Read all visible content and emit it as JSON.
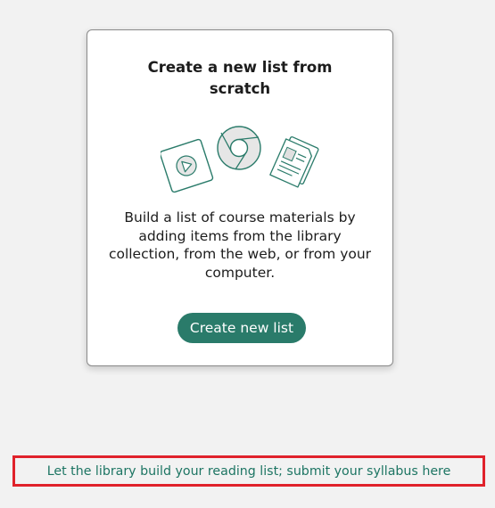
{
  "card": {
    "title": "Create a new list from scratch",
    "description": "Build a list of course materials by adding items from the library collection, from the web, or from your computer.",
    "button_label": "Create new list"
  },
  "illustration_icons": [
    "video-play-icon",
    "web-browser-icon",
    "document-icon"
  ],
  "footer": {
    "syllabus_link": "Let the library build your reading list; submit your syllabus here"
  },
  "colors": {
    "accent": "#2a7b6a",
    "link": "#1d7563",
    "highlight_border": "#e0222b",
    "background": "#f2f2f2"
  }
}
